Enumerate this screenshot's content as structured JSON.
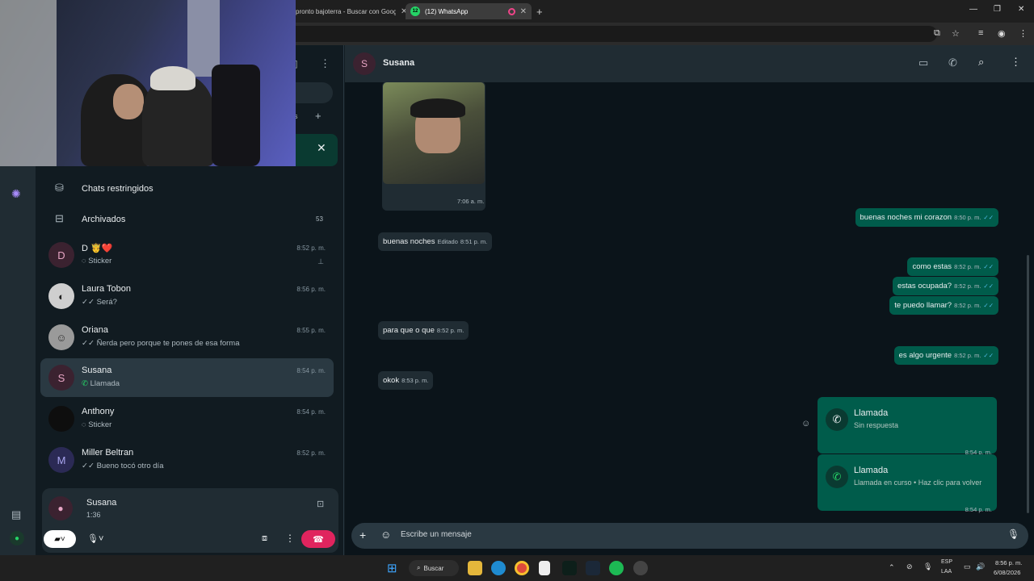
{
  "browser": {
    "tabs": [
      {
        "title": "pronto bajoterra - Buscar con Google"
      },
      {
        "title": "(12) WhatsApp",
        "badge": "12"
      }
    ]
  },
  "sidebar": {
    "restricted_label": "Chats restringidos",
    "archived_label": "Archivados",
    "archived_count": "53",
    "chats": [
      {
        "name": "D 🤴❤️",
        "preview": "Sticker",
        "time": "8:52 p. m.",
        "avatar": "D",
        "pinned": true
      },
      {
        "name": "Laura Tobon",
        "preview": "Será?",
        "time": "8:56 p. m.",
        "avatar": ""
      },
      {
        "name": "Oriana",
        "preview": "Ñerda pero porque te pones de esa forma",
        "time": "8:55 p. m.",
        "avatar": ""
      },
      {
        "name": "Susana",
        "preview": "Llamada",
        "time": "8:54 p. m.",
        "avatar": "S"
      },
      {
        "name": "Anthony",
        "preview": "Sticker",
        "time": "8:54 p. m.",
        "avatar": ""
      },
      {
        "name": "Miller Beltran",
        "preview": "Bueno tocó otro día",
        "time": "8:52 p. m.",
        "avatar": "M"
      }
    ],
    "active_call": {
      "name": "Susana",
      "duration": "1:36"
    }
  },
  "chat": {
    "contact_name": "Susana",
    "contact_initial": "S",
    "image_time": "7:06 a. m.",
    "messages": [
      {
        "dir": "out",
        "text": "buenas noches mi corazon",
        "time": "8:50 p. m."
      },
      {
        "dir": "in",
        "text": "buenas noches",
        "time": "8:51 p. m.",
        "edited": "Editado"
      },
      {
        "dir": "out",
        "text": "como estas",
        "time": "8:52 p. m."
      },
      {
        "dir": "out",
        "text": "estas ocupada?",
        "time": "8:52 p. m."
      },
      {
        "dir": "out",
        "text": "te puedo llamar?",
        "time": "8:52 p. m."
      },
      {
        "dir": "in",
        "text": "para que o que",
        "time": "8:52 p. m."
      },
      {
        "dir": "out",
        "text": "es algo urgente",
        "time": "8:52 p. m."
      },
      {
        "dir": "in",
        "text": "okok",
        "time": "8:53 p. m."
      }
    ],
    "calls": [
      {
        "title": "Llamada",
        "subtitle": "Sin respuesta",
        "time": "8:54 p. m."
      },
      {
        "title": "Llamada",
        "subtitle": "Llamada en curso • Haz clic para volver",
        "time": "8:54 p. m."
      }
    ],
    "composer_placeholder": "Escribe un mensaje"
  },
  "taskbar": {
    "search_label": "Buscar",
    "lang": "ESP",
    "lang_sub": "LAA",
    "time": "8:56 p. m.",
    "date": "6/08/2026"
  },
  "colors": {
    "accent": "#00a884",
    "bubble_out": "#005c4b",
    "bubble_in": "#202c33",
    "hangup": "#e0245e"
  }
}
